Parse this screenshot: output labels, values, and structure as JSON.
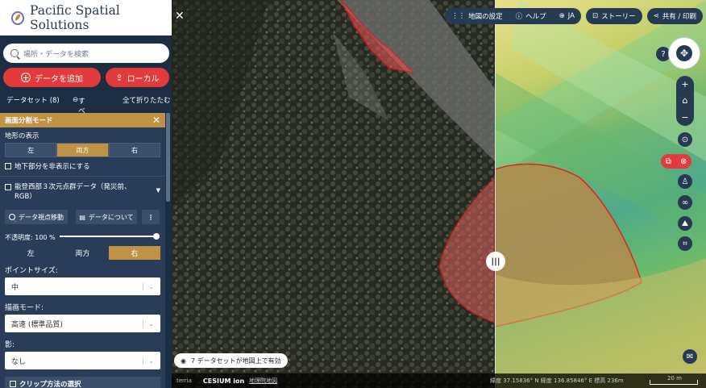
{
  "brand": {
    "title": "Pacific Spatial Solutions"
  },
  "search": {
    "placeholder": "場所・データを検索"
  },
  "buttons": {
    "add_data": "データを追加",
    "local": "ローカル"
  },
  "datasets": {
    "label": "データセット (8)",
    "remove_all": "すべて削除",
    "collapse_all": "全て折りたたむ"
  },
  "split_mode": {
    "title": "画面分割モード",
    "terrain_label": "地形の表示",
    "sides": [
      "左",
      "両方",
      "右"
    ],
    "selected_side": "両方",
    "underground": "地下部分を非表示にする"
  },
  "dataset_item": {
    "title": "能登西部３次元点群データ（発災前、RGB）",
    "goto": "データ視点移動",
    "about": "データについて",
    "opacity": "不透明度: 100 %",
    "opacity_value": 1.0,
    "sides": [
      "左",
      "両方",
      "右"
    ],
    "selected_side": "右",
    "point_size_label": "ポイントサイズ:",
    "point_size_value": "中",
    "render_mode_label": "描画モード:",
    "render_mode_value": "高速 (標準品質)",
    "shadow_label": "影:",
    "shadow_value": "なし",
    "clip_label": "クリップ方法の選択"
  },
  "topbar": {
    "map_settings": "地図の設定",
    "help": "ヘルプ",
    "lang": "JA",
    "story": "ストーリー",
    "share": "共有 / 印刷"
  },
  "notice": "7 データセットが地図上で有効",
  "footer": {
    "terria": "terria",
    "cesium": "CESIUM ion",
    "attribution": "地理院地図",
    "coords": "緯度  37.15836° N    経度  136.85846° E    標高  236m",
    "scale": "20 m"
  },
  "colors": {
    "accent": "#bf9245",
    "red": "#e23b3b",
    "panel": "#1d2d44"
  }
}
